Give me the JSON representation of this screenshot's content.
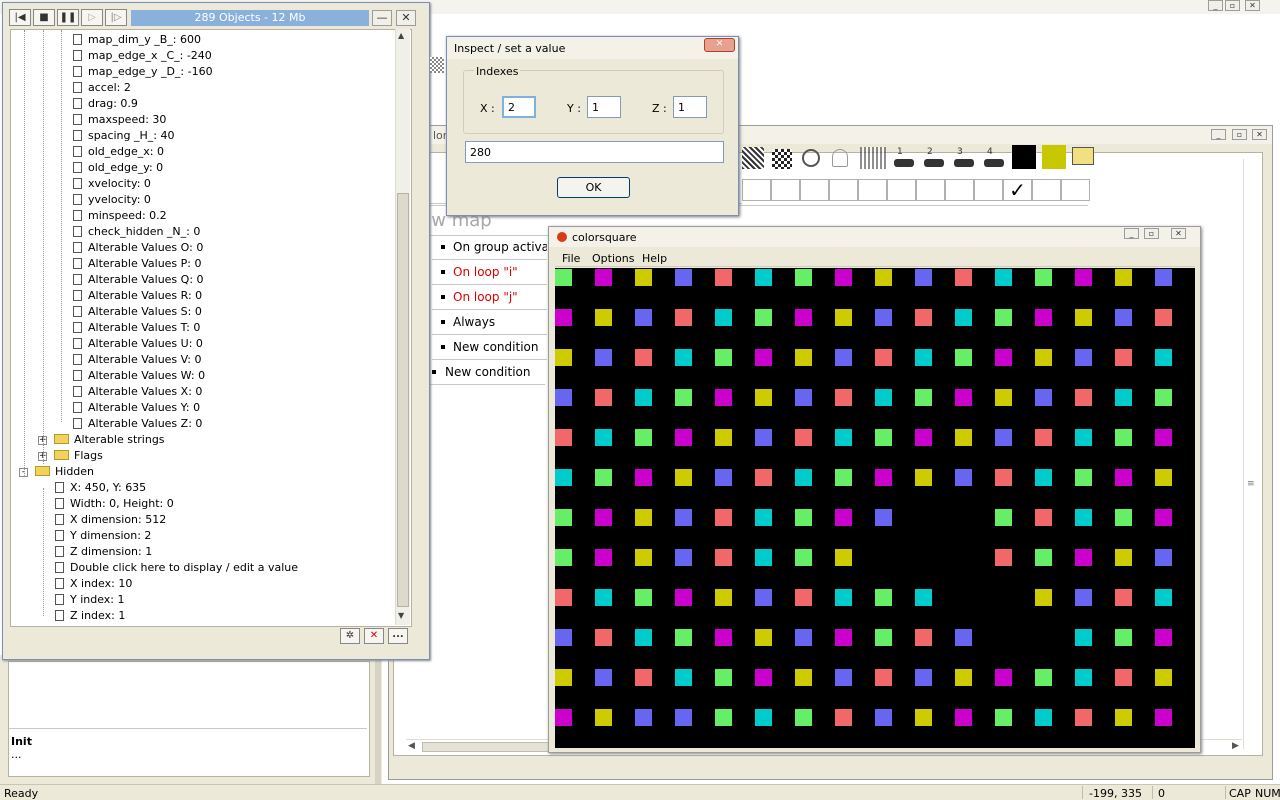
{
  "object_panel": {
    "title": "289 Objects - 12 Mb",
    "tree_items": [
      {
        "label": "map_dim_y _B_: 600",
        "level": 3
      },
      {
        "label": "map_edge_x _C_: -240",
        "level": 3
      },
      {
        "label": "map_edge_y _D_: -160",
        "level": 3
      },
      {
        "label": "accel: 2",
        "level": 3
      },
      {
        "label": "drag: 0.9",
        "level": 3
      },
      {
        "label": "maxspeed: 30",
        "level": 3
      },
      {
        "label": "spacing _H_: 40",
        "level": 3
      },
      {
        "label": "old_edge_x: 0",
        "level": 3
      },
      {
        "label": "old_edge_y: 0",
        "level": 3
      },
      {
        "label": "xvelocity: 0",
        "level": 3
      },
      {
        "label": "yvelocity: 0",
        "level": 3
      },
      {
        "label": "minspeed: 0.2",
        "level": 3
      },
      {
        "label": "check_hidden _N_: 0",
        "level": 3
      },
      {
        "label": "Alterable Values O: 0",
        "level": 3
      },
      {
        "label": "Alterable Values P: 0",
        "level": 3
      },
      {
        "label": "Alterable Values Q: 0",
        "level": 3
      },
      {
        "label": "Alterable Values R: 0",
        "level": 3
      },
      {
        "label": "Alterable Values S: 0",
        "level": 3
      },
      {
        "label": "Alterable Values T: 0",
        "level": 3
      },
      {
        "label": "Alterable Values U: 0",
        "level": 3
      },
      {
        "label": "Alterable Values V: 0",
        "level": 3
      },
      {
        "label": "Alterable Values W: 0",
        "level": 3
      },
      {
        "label": "Alterable Values X: 0",
        "level": 3
      },
      {
        "label": "Alterable Values Y: 0",
        "level": 3
      },
      {
        "label": "Alterable Values Z: 0",
        "level": 3
      },
      {
        "label": "Alterable strings",
        "level": 2,
        "folder": true,
        "expand": "+"
      },
      {
        "label": "Flags",
        "level": 2,
        "folder": true,
        "expand": "+"
      },
      {
        "label": "Hidden",
        "level": 1,
        "folder": true,
        "expand": "-"
      },
      {
        "label": "X: 450, Y: 635",
        "level": 2
      },
      {
        "label": "Width: 0, Height: 0",
        "level": 2
      },
      {
        "label": "X dimension: 512",
        "level": 2
      },
      {
        "label": "Y dimension: 2",
        "level": 2
      },
      {
        "label": "Z dimension: 1",
        "level": 2
      },
      {
        "label": "Double click here to display / edit a value",
        "level": 2
      },
      {
        "label": "X index: 10",
        "level": 2
      },
      {
        "label": "Y index: 1",
        "level": 2
      },
      {
        "label": "Z index: 1",
        "level": 2
      }
    ],
    "bottom_buttons": [
      "refresh-icon",
      "delete-icon",
      "more-icon"
    ],
    "more_label": "..."
  },
  "dialog": {
    "title": "Inspect / set a value",
    "group_label": "Indexes",
    "x_label": "X :",
    "x_value": "2",
    "y_label": "Y :",
    "y_value": "1",
    "z_label": "Z :",
    "z_value": "1",
    "value": "280",
    "ok_label": "OK"
  },
  "colorsquare": {
    "title": "colorsquare",
    "menu": [
      "File",
      "Options",
      "Help"
    ],
    "palette": {
      "a": "#f06868",
      "b": "#00cccc",
      "c": "#66ee66",
      "d": "#cc00cc",
      "e": "#cccc00",
      "f": "#6666f0",
      "R": "#ff0000"
    },
    "grid": [
      "cdefabcdefabcdefa",
      "defabcdefabcdefab",
      "efabcdefabcdefabc",
      "fabcdefabcdefabcd",
      "abcdefabcdefabcde",
      "bcdefabcdefabcdef",
      "cdefabcdfR.cabcde",
      "cdefabce...acdefa",
      "abcdefabcb..efabc",
      "fabcdefdcaf..bcdf",
      "efabcdefafedcbaef",
      "deffcbcafedcbaede"
    ]
  },
  "editor": {
    "title_fragment": "lorsq",
    "section_label": "Draw map",
    "events": [
      {
        "label": "On group activat",
        "color": "#000000"
      },
      {
        "label": "On loop \"i\"",
        "color": "#e00000"
      },
      {
        "label": "On loop \"j\"",
        "color": "#e00000"
      },
      {
        "label": "Always",
        "color": "#000000"
      },
      {
        "label": "New condition",
        "color": "#000000"
      }
    ],
    "new_condition_label": "New condition",
    "checkmark": "✓"
  },
  "left_bottom": {
    "heading": "Init",
    "text": "..."
  },
  "statusbar": {
    "status": "Ready",
    "coords": "-199, 335",
    "value": "0",
    "cap": "CAP",
    "num": "NUM"
  }
}
